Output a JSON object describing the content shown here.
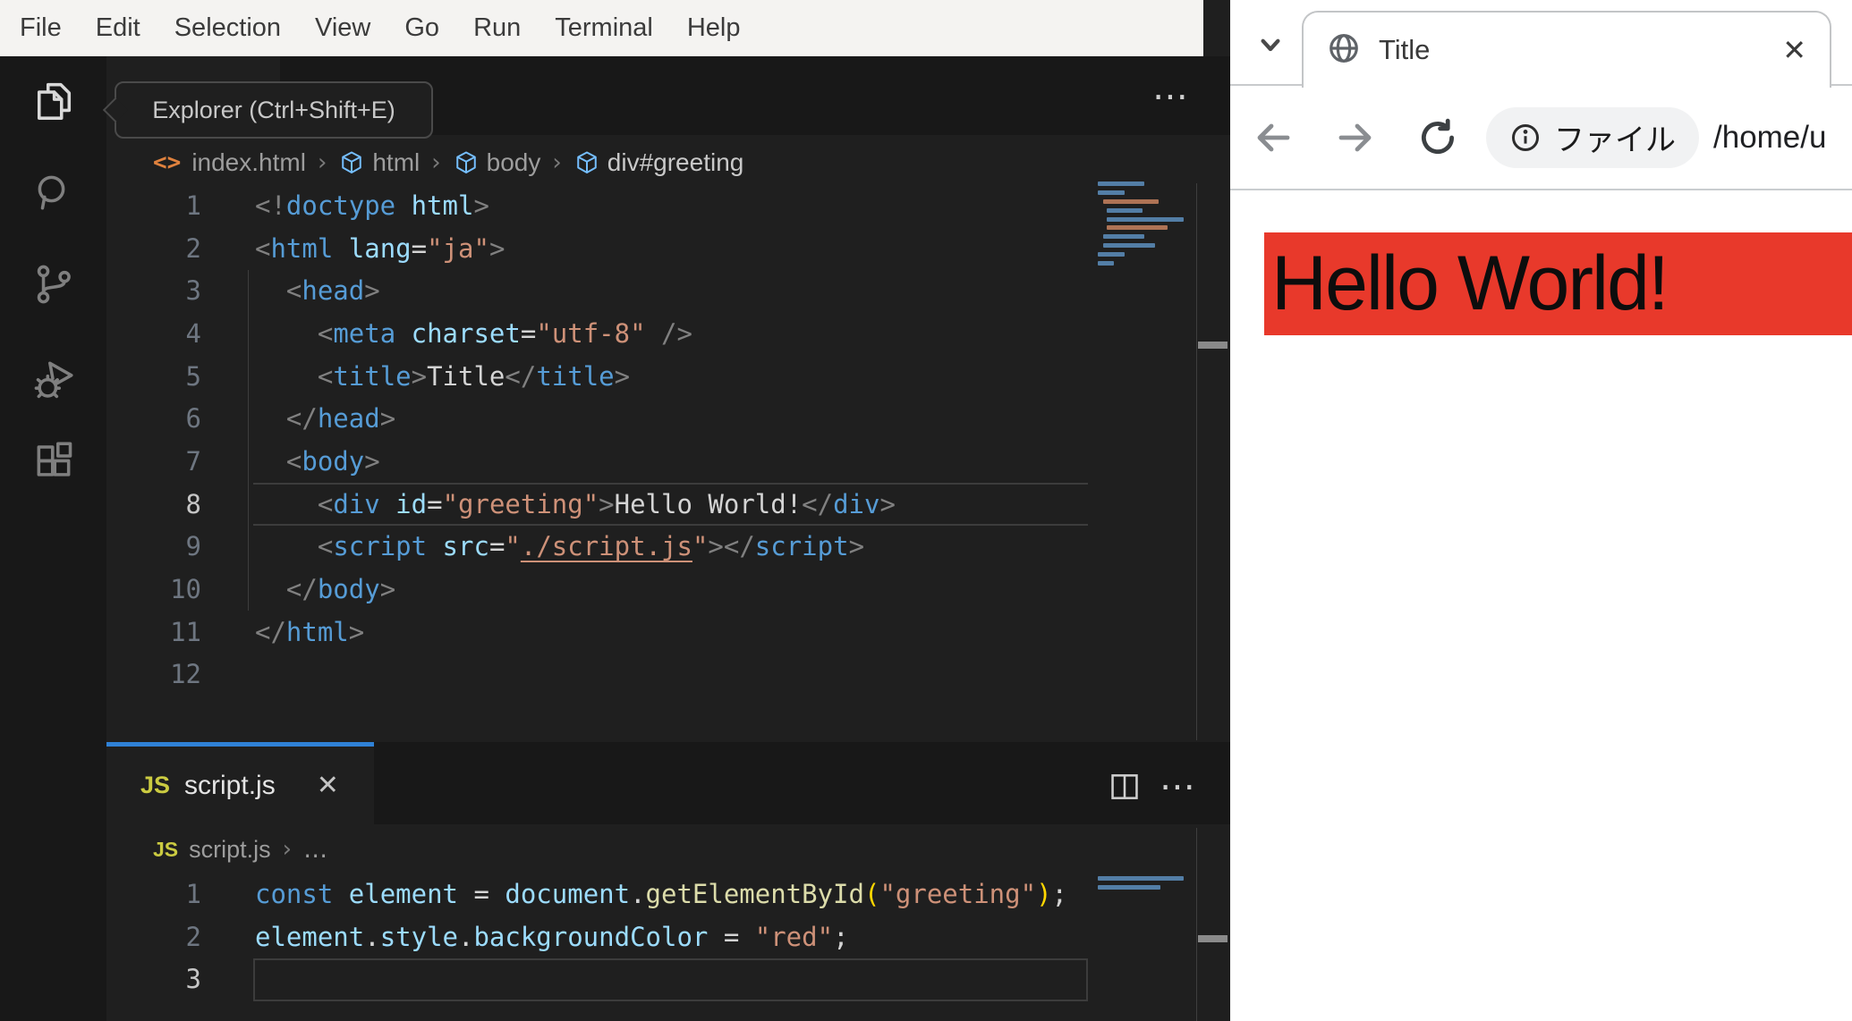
{
  "vscode": {
    "menubar": {
      "items": [
        "File",
        "Edit",
        "Selection",
        "View",
        "Go",
        "Run",
        "Terminal",
        "Help"
      ]
    },
    "tooltip": {
      "text": "Explorer (Ctrl+Shift+E)"
    },
    "icons": {
      "more": "⋯",
      "close": "✕",
      "breadcrumb_sep": "›",
      "ellipsis": "…",
      "html_file": "<>",
      "js_badge": "JS"
    },
    "html_editor": {
      "breadcrumbs": {
        "file": "index.html",
        "segments": [
          "html",
          "body",
          "div#greeting"
        ]
      },
      "code": {
        "active_line": 8,
        "lines": [
          [
            [
              "<!",
              "p"
            ],
            [
              "doctype",
              "t"
            ],
            [
              " html",
              "a"
            ],
            [
              ">",
              "p"
            ]
          ],
          [
            [
              "<",
              "p"
            ],
            [
              "html",
              "t"
            ],
            [
              " ",
              "x"
            ],
            [
              "lang",
              "a"
            ],
            [
              "=",
              "x"
            ],
            [
              "\"ja\"",
              "s"
            ],
            [
              ">",
              "p"
            ]
          ],
          [
            [
              "  ",
              "x"
            ],
            [
              "<",
              "p"
            ],
            [
              "head",
              "t"
            ],
            [
              ">",
              "p"
            ]
          ],
          [
            [
              "    ",
              "x"
            ],
            [
              "<",
              "p"
            ],
            [
              "meta",
              "t"
            ],
            [
              " ",
              "x"
            ],
            [
              "charset",
              "a"
            ],
            [
              "=",
              "x"
            ],
            [
              "\"utf-8\"",
              "s"
            ],
            [
              " /",
              "p"
            ],
            [
              ">",
              "p"
            ]
          ],
          [
            [
              "    ",
              "x"
            ],
            [
              "<",
              "p"
            ],
            [
              "title",
              "t"
            ],
            [
              ">",
              "p"
            ],
            [
              "Title",
              "x"
            ],
            [
              "</",
              "p"
            ],
            [
              "title",
              "t"
            ],
            [
              ">",
              "p"
            ]
          ],
          [
            [
              "  ",
              "x"
            ],
            [
              "</",
              "p"
            ],
            [
              "head",
              "t"
            ],
            [
              ">",
              "p"
            ]
          ],
          [
            [
              "  ",
              "x"
            ],
            [
              "<",
              "p"
            ],
            [
              "body",
              "t"
            ],
            [
              ">",
              "p"
            ]
          ],
          [
            [
              "    ",
              "x"
            ],
            [
              "<",
              "p"
            ],
            [
              "div",
              "t"
            ],
            [
              " ",
              "x"
            ],
            [
              "id",
              "a"
            ],
            [
              "=",
              "x"
            ],
            [
              "\"greeting\"",
              "s"
            ],
            [
              ">",
              "p"
            ],
            [
              "Hello World!",
              "x"
            ],
            [
              "</",
              "p"
            ],
            [
              "div",
              "t"
            ],
            [
              ">",
              "p"
            ]
          ],
          [
            [
              "    ",
              "x"
            ],
            [
              "<",
              "p"
            ],
            [
              "script",
              "t"
            ],
            [
              " ",
              "x"
            ],
            [
              "src",
              "a"
            ],
            [
              "=",
              "x"
            ],
            [
              "\"",
              "s"
            ],
            [
              "./script.js",
              "l"
            ],
            [
              "\"",
              "s"
            ],
            [
              ">",
              "p"
            ],
            [
              "</",
              "p"
            ],
            [
              "script",
              "t"
            ],
            [
              ">",
              "p"
            ]
          ],
          [
            [
              "  ",
              "x"
            ],
            [
              "</",
              "p"
            ],
            [
              "body",
              "t"
            ],
            [
              ">",
              "p"
            ]
          ],
          [
            [
              "</",
              "p"
            ],
            [
              "html",
              "t"
            ],
            [
              ">",
              "p"
            ]
          ],
          []
        ]
      }
    },
    "js_editor": {
      "tab": {
        "label": "script.js"
      },
      "breadcrumbs": {
        "file": "script.js"
      },
      "code": {
        "active_line": 3,
        "lines": [
          [
            [
              "const",
              "k"
            ],
            [
              " ",
              "x"
            ],
            [
              "element",
              "v"
            ],
            [
              " = ",
              "x"
            ],
            [
              "document",
              "v"
            ],
            [
              ".",
              "x"
            ],
            [
              "getElementById",
              "f"
            ],
            [
              "(",
              "b"
            ],
            [
              "\"greeting\"",
              "s"
            ],
            [
              ")",
              "b"
            ],
            [
              ";",
              "x"
            ]
          ],
          [
            [
              "element",
              "v"
            ],
            [
              ".",
              "x"
            ],
            [
              "style",
              "v"
            ],
            [
              ".",
              "x"
            ],
            [
              "backgroundColor",
              "v"
            ],
            [
              " = ",
              "x"
            ],
            [
              "\"red\"",
              "s"
            ],
            [
              ";",
              "x"
            ]
          ],
          []
        ]
      }
    }
  },
  "browser": {
    "tab": {
      "title": "Title"
    },
    "address_bar": {
      "chip_label": "ファイル",
      "url": "/home/u"
    },
    "page": {
      "heading": "Hello World!",
      "heading_bg": "#e8392b"
    }
  },
  "colors": {
    "tab_indicator": "#2f81d7",
    "accent_red": "#e8392b"
  }
}
